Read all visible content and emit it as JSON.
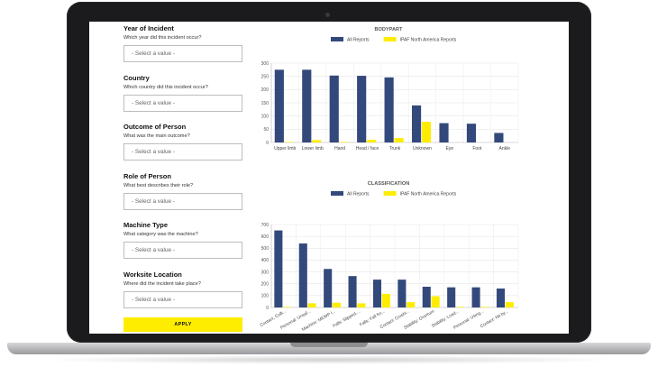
{
  "filters": [
    {
      "title": "Year of Incident",
      "desc": "Which year did this incident occur?",
      "placeholder": "- Select a value -"
    },
    {
      "title": "Country",
      "desc": "Which country did this incident occur?",
      "placeholder": "- Select a value -"
    },
    {
      "title": "Outcome of Person",
      "desc": "What was the main outcome?",
      "placeholder": "- Select a value -"
    },
    {
      "title": "Role of Person",
      "desc": "What best describes their role?",
      "placeholder": "- Select a value -"
    },
    {
      "title": "Machine Type",
      "desc": "What category was the machine?",
      "placeholder": "- Select a value -"
    },
    {
      "title": "Worksite Location",
      "desc": "Where did the incident take place?",
      "placeholder": "- Select a value -"
    }
  ],
  "apply_label": "APPLY",
  "colors": {
    "series_all": "#34497b",
    "series_ipaf": "#ffed00",
    "accent": "#ffed00"
  },
  "chart_data": [
    {
      "type": "bar",
      "title": "BODYPART",
      "categories": [
        "Upper limb",
        "Lower limb",
        "Hand",
        "Head / face",
        "Trunk",
        "Unknown",
        "Eye",
        "Foot",
        "Ankle"
      ],
      "series": [
        {
          "name": "All Reports",
          "values": [
            275,
            275,
            253,
            252,
            246,
            140,
            73,
            71,
            36
          ]
        },
        {
          "name": "IPAF North America Reports",
          "values": [
            2,
            9,
            2,
            10,
            17,
            78,
            0,
            0,
            0
          ]
        }
      ],
      "ylim": [
        0,
        300
      ],
      "yticks": [
        0,
        50,
        100,
        150,
        200,
        250,
        300
      ],
      "grid": true,
      "legend": "top"
    },
    {
      "type": "bar",
      "title": "CLASSIFICATION",
      "categories": [
        "Contact, Colli...",
        "Personal: Unsaf...",
        "Machine: MEWP I...",
        "Falls: Slipped,...",
        "Falls: Fall fro...",
        "Contact: Crushi...",
        "Stability: Overturn",
        "Stability: Load...",
        "Personal: Using...",
        "Contact: Hit by..."
      ],
      "series": [
        {
          "name": "All Reports",
          "values": [
            650,
            540,
            325,
            265,
            235,
            235,
            175,
            170,
            170,
            160
          ]
        },
        {
          "name": "IPAF North America Reports",
          "values": [
            5,
            35,
            40,
            35,
            115,
            45,
            95,
            5,
            5,
            45
          ]
        }
      ],
      "ylim": [
        0,
        700
      ],
      "yticks": [
        0,
        100,
        200,
        300,
        400,
        500,
        600,
        700
      ],
      "grid": true,
      "legend": "top"
    }
  ]
}
